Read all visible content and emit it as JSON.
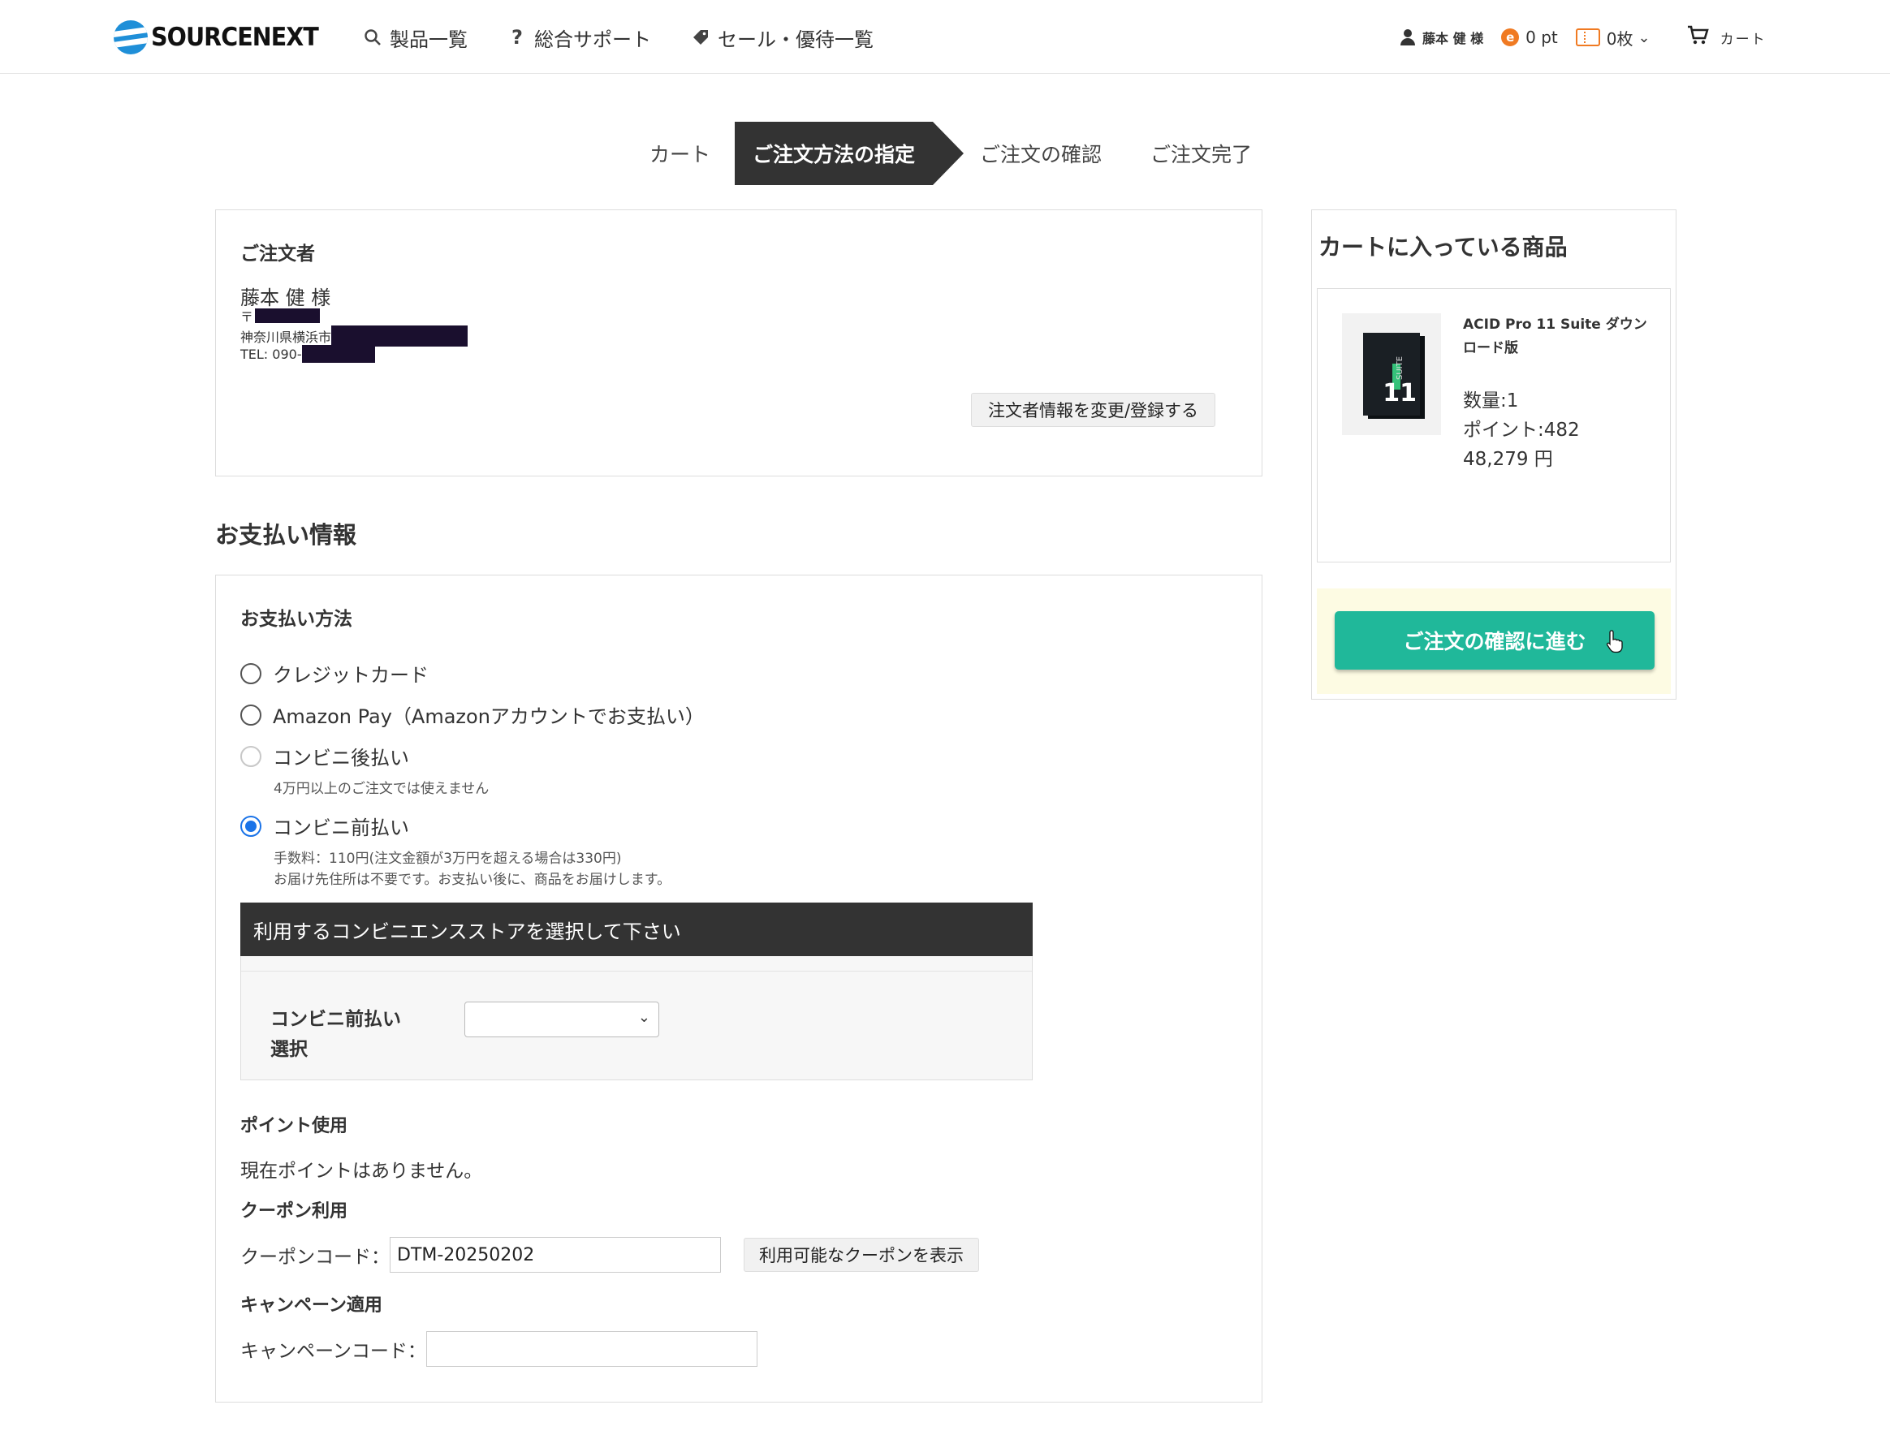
{
  "header": {
    "logo_text": "SOURCENEXT",
    "nav": [
      {
        "label": "製品一覧",
        "icon": "search-icon"
      },
      {
        "label": "総合サポート",
        "icon": "question-icon"
      },
      {
        "label": "セール・優待一覧",
        "icon": "tag-icon"
      }
    ],
    "user_name": "藤本 健 様",
    "points": "0 pt",
    "tickets": "0枚",
    "cart_label": "カート"
  },
  "steps": [
    {
      "label": "カート",
      "active": false
    },
    {
      "label": "ご注文方法の指定",
      "active": true
    },
    {
      "label": "ご注文の確認",
      "active": false
    },
    {
      "label": "ご注文完了",
      "active": false
    }
  ],
  "orderer": {
    "title": "ご注文者",
    "name": "藤本 健 様",
    "postal_prefix": "〒",
    "address_prefix": "神奈川県横浜市",
    "tel_prefix": "TEL: 090-",
    "edit_button": "注文者情報を変更/登録する"
  },
  "payment": {
    "heading": "お支払い情報",
    "method_title": "お支払い方法",
    "options": [
      {
        "label": "クレジットカード",
        "state": "unchecked"
      },
      {
        "label": "Amazon Pay（Amazonアカウントでお支払い）",
        "state": "unchecked"
      },
      {
        "label": "コンビニ後払い",
        "state": "disabled",
        "note": "4万円以上のご注文では使えません"
      },
      {
        "label": "コンビニ前払い",
        "state": "checked",
        "note1": "手数料：110円(注文金額が3万円を超える場合は330円)",
        "note2": "お届け先住所は不要です。お支払い後に、商品をお届けします。"
      }
    ],
    "store_bar": "利用するコンビニエンスストアを選択して下さい",
    "store_label": "コンビニ前払い選択",
    "store_selected": ""
  },
  "points_section": {
    "title": "ポイント使用",
    "text": "現在ポイントはありません。"
  },
  "coupon": {
    "title": "クーポン利用",
    "label": "クーポンコード：",
    "value": "DTM-20250202",
    "button": "利用可能なクーポンを表示"
  },
  "campaign": {
    "title": "キャンペーン適用",
    "label": "キャンペーンコード：",
    "value": ""
  },
  "cart_sidebar": {
    "title": "カートに入っている商品",
    "product_name": "ACID Pro 11 Suite ダウンロード版",
    "quantity": "数量:1",
    "points": "ポイント:482",
    "price": "48,279 円",
    "box_suite": "SUITE",
    "box_num": "11",
    "cta": "ご注文の確認に進む"
  },
  "colors": {
    "accent_green": "#20b89a",
    "step_active": "#333333",
    "radio_checked": "#1a73e8",
    "point_orange": "#f07a22",
    "cta_bg": "#fdfbe3"
  }
}
